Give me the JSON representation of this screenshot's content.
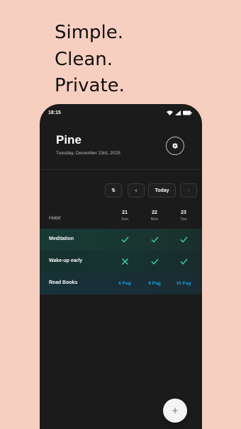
{
  "promo": {
    "line1": "Simple.",
    "line2": "Clean.",
    "line3": "Private."
  },
  "status_bar": {
    "time": "18:15",
    "icons": [
      "wifi-icon",
      "signal-icon",
      "battery-icon"
    ]
  },
  "header": {
    "title": "Pine",
    "date": "Tuesday, December 23rd, 2025",
    "settings_icon": "gear-icon"
  },
  "toolbar": {
    "sort_label": "⇅",
    "prev_label": "‹",
    "today_label": "Today",
    "next_label": "›"
  },
  "table": {
    "habit_header": "Habit",
    "days": [
      {
        "num": "21",
        "dow": "Sun"
      },
      {
        "num": "22",
        "dow": "Mon"
      },
      {
        "num": "23",
        "dow": "Tue"
      }
    ],
    "rows": [
      {
        "label": "Meditation",
        "cells": [
          "check",
          "check",
          "check"
        ]
      },
      {
        "label": "Wake-up early",
        "cells": [
          "cross",
          "check",
          "check"
        ]
      },
      {
        "label": "Read Books",
        "cells": [
          "6 Pag",
          "8 Pag",
          "10 Pag"
        ]
      }
    ]
  },
  "fab": {
    "icon": "plus-icon"
  },
  "colors": {
    "background": "#f7cfc0",
    "phone": "#1b1b1b",
    "check": "#3ccfa8",
    "pages": "#1aa0d6"
  }
}
